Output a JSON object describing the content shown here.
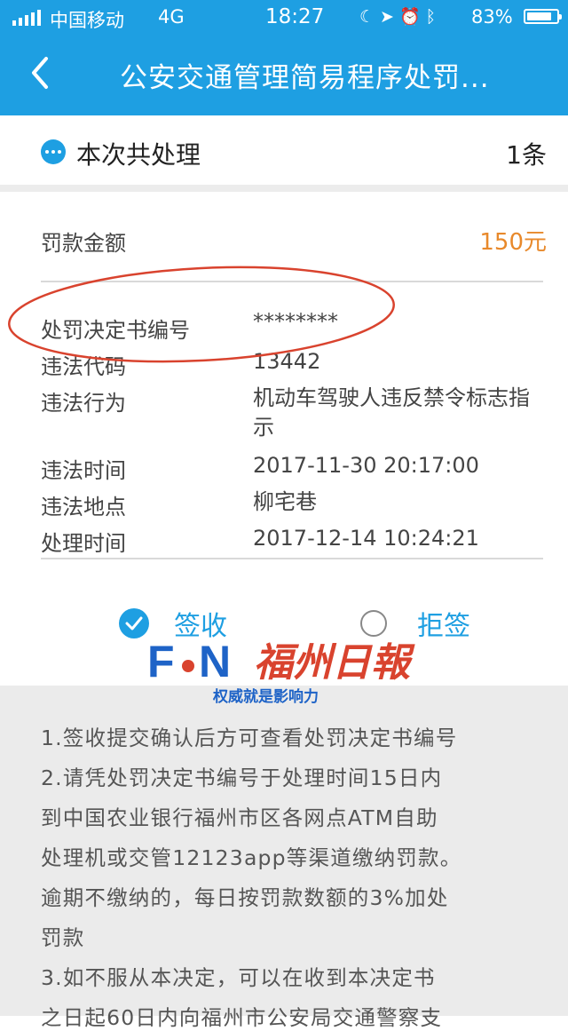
{
  "status_bar": {
    "carrier": "中国移动",
    "network": "4G",
    "time": "18:27",
    "icons": [
      "moon-icon",
      "location-arrow-icon",
      "alarm-icon",
      "bluetooth-icon"
    ],
    "battery_percent": "83%",
    "battery_level": 0.83
  },
  "nav": {
    "back_icon": "chevron-left-icon",
    "title": "公安交通管理简易程序处罚..."
  },
  "summary": {
    "label": "本次共处理",
    "count": "1条"
  },
  "details": {
    "fine_label": "罚款金额",
    "fine_amount": "150元",
    "rows": [
      {
        "label": "处罚决定书编号",
        "value": "********"
      },
      {
        "label": "违法代码",
        "value": "13442"
      },
      {
        "label": "违法行为",
        "value": "机动车驾驶人违反禁令标志指示"
      },
      {
        "label": "违法时间",
        "value": "2017-11-30 20:17:00"
      },
      {
        "label": "违法地点",
        "value": "柳宅巷"
      },
      {
        "label": "处理时间",
        "value": "2017-12-14 10:24:21"
      }
    ]
  },
  "sign_options": {
    "accept_label": "签收",
    "reject_label": "拒签",
    "selected": "签收"
  },
  "watermark": {
    "logo_text": "F.N",
    "logo_name": "福州日报",
    "slogan": "权威就是影响力"
  },
  "notice": {
    "lines": [
      "1.签收提交确认后方可查看处罚决定书编号",
      "2.请凭处罚决定书编号于处理时间15日内",
      "到中国农业银行福州市区各网点ATM自助",
      "处理机或交管12123app等渠道缴纳罚款。",
      "逾期不缴纳的，每日按罚款数额的3%加处",
      "罚款",
      "3.如不服从本决定，可以在收到本决定书",
      "之日起60日内向福州市公安局交通警察支"
    ]
  },
  "colors": {
    "brand": "#1E9FE2",
    "amount": "#E8892B",
    "annotation": "#D9432E"
  }
}
